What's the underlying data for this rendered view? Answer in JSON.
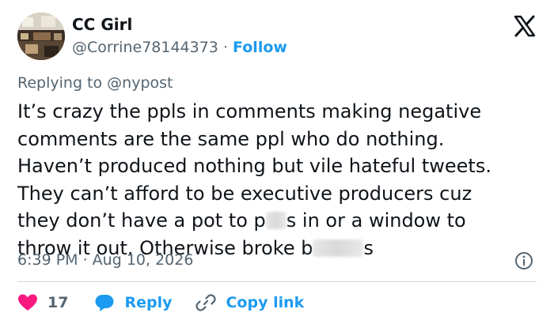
{
  "user": {
    "display_name": "CC Girl",
    "handle": "@Corrine78144373",
    "separator": "·",
    "follow_label": "Follow"
  },
  "reply": {
    "prefix": "Replying to",
    "mention": "@nypost"
  },
  "tweet": {
    "lines": [
      "It’s crazy the ppls in comments making negative",
      "comments are the same ppl who do nothing.",
      "Haven’t produced nothing but vile hateful tweets.",
      "They can’t afford to be executive producers cuz"
    ],
    "line5_a": "they don’t have a pot to p",
    "line5_b": "s in or a window to",
    "line6_a": "throw it out. Otherwise broke b",
    "line6_b": "s"
  },
  "meta": {
    "timestamp": "6:39 PM · Aug 10, 2026"
  },
  "actions": {
    "like_count": "17",
    "reply_label": "Reply",
    "copy_link_label": "Copy link"
  },
  "icons": {
    "logo": "x-logo-icon",
    "info": "info-icon",
    "like": "heart-icon",
    "reply": "speech-bubble-icon",
    "copy": "link-icon"
  },
  "colors": {
    "accent": "#1d9bf0",
    "like": "#f91880",
    "text": "#0f1419",
    "secondary": "#536471"
  }
}
